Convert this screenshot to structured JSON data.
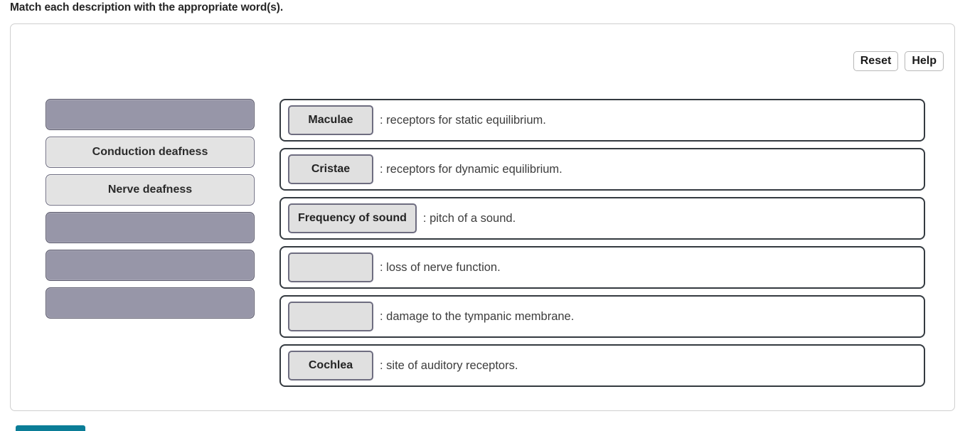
{
  "prompt": "Match each description with the appropriate word(s).",
  "toolbar": {
    "reset_label": "Reset",
    "help_label": "Help"
  },
  "wordbank": {
    "tiles": [
      {
        "label": "",
        "state": "filled"
      },
      {
        "label": "Conduction deafness",
        "state": "word"
      },
      {
        "label": "Nerve deafness",
        "state": "word"
      },
      {
        "label": "",
        "state": "filled"
      },
      {
        "label": "",
        "state": "filled"
      },
      {
        "label": "",
        "state": "filled"
      }
    ]
  },
  "rows": [
    {
      "answer": "Maculae",
      "description": ": receptors for static equilibrium."
    },
    {
      "answer": "Cristae",
      "description": ": receptors for dynamic equilibrium."
    },
    {
      "answer": "Frequency of sound",
      "description": ": pitch of a sound."
    },
    {
      "answer": "",
      "description": ": loss of nerve function."
    },
    {
      "answer": "",
      "description": ": damage to the tympanic membrane."
    },
    {
      "answer": "Cochlea",
      "description": ": site of auditory receptors."
    }
  ],
  "submit": {
    "label": ""
  },
  "colors": {
    "slot_filled": "#9796a8",
    "slot_border": "#5f5e70",
    "tile_face": "#e3e3e3",
    "row_border": "#343a40",
    "submit": "#0b7d97"
  }
}
